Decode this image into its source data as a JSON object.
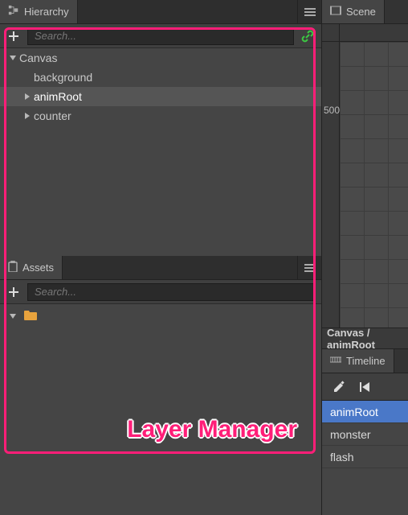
{
  "hierarchy": {
    "tab_label": "Hierarchy",
    "search_placeholder": "Search...",
    "tree": [
      {
        "label": "Canvas",
        "depth": 0,
        "expanded": true,
        "hasChildren": true,
        "selected": false
      },
      {
        "label": "background",
        "depth": 1,
        "expanded": false,
        "hasChildren": false,
        "selected": false
      },
      {
        "label": "animRoot",
        "depth": 1,
        "expanded": false,
        "hasChildren": true,
        "selected": true
      },
      {
        "label": "counter",
        "depth": 1,
        "expanded": false,
        "hasChildren": true,
        "selected": false
      }
    ]
  },
  "assets": {
    "tab_label": "Assets",
    "search_placeholder": "Search..."
  },
  "scene": {
    "tab_label": "Scene",
    "ruler_tick": "500",
    "breadcrumb": "Canvas / animRoot"
  },
  "timeline": {
    "tab_label": "Timeline",
    "rows": [
      {
        "label": "animRoot",
        "selected": true
      },
      {
        "label": "monster",
        "selected": false
      },
      {
        "label": "flash",
        "selected": false
      }
    ]
  },
  "callout": {
    "label": "Layer Manager"
  }
}
